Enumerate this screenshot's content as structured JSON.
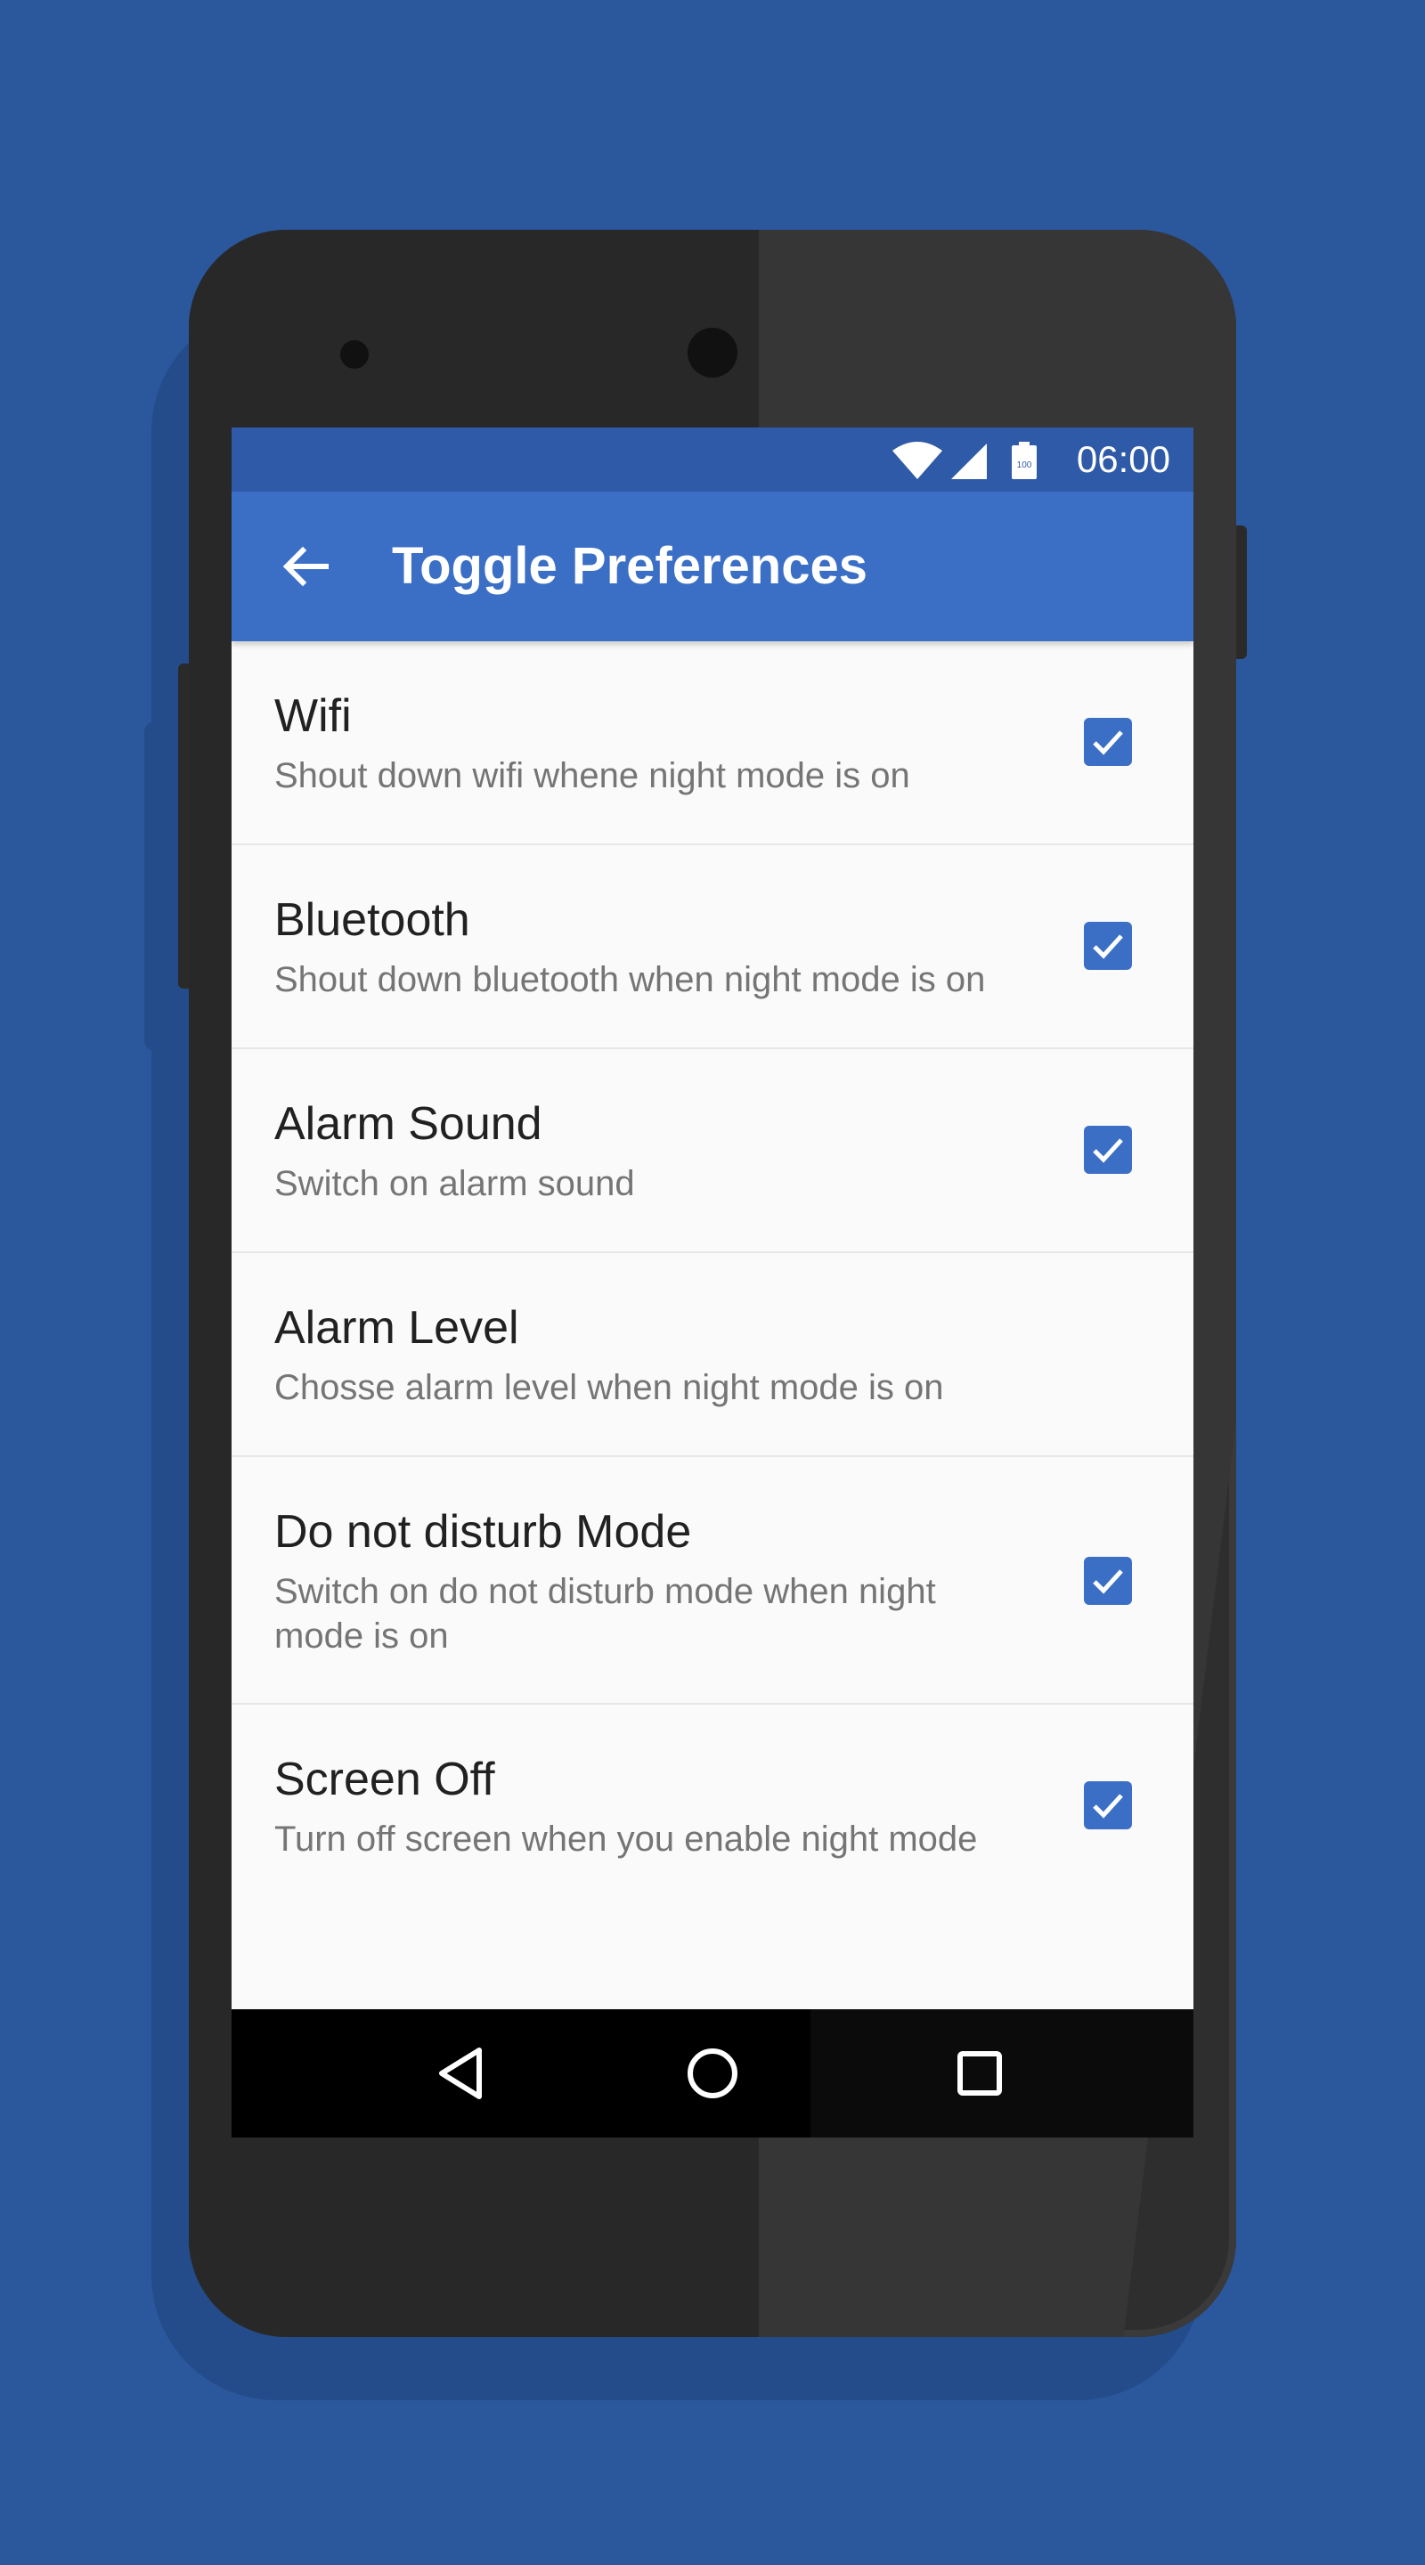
{
  "status_bar": {
    "time": "06:00",
    "battery_label": "100",
    "icons": [
      "wifi-icon",
      "signal-icon",
      "battery-icon"
    ]
  },
  "app_bar": {
    "title": "Toggle Preferences",
    "back_icon": "arrow-left-icon"
  },
  "preferences": [
    {
      "title": "Wifi",
      "subtitle": "Shout down wifi whene night mode is on",
      "checked": true
    },
    {
      "title": "Bluetooth",
      "subtitle": "Shout down bluetooth when night mode is on",
      "checked": true
    },
    {
      "title": "Alarm Sound",
      "subtitle": "Switch on alarm sound",
      "checked": true
    },
    {
      "title": "Alarm Level",
      "subtitle": "Chosse alarm level when night mode is on",
      "checked": false
    },
    {
      "title": "Do not disturb Mode",
      "subtitle": "Switch on do not disturb mode when night mode is on",
      "checked": true
    },
    {
      "title": "Screen Off",
      "subtitle": "Turn off screen when you enable night mode",
      "checked": true
    }
  ],
  "nav_bar": {
    "icons": [
      "back-triangle-icon",
      "home-circle-icon",
      "recents-square-icon"
    ]
  },
  "colors": {
    "background": "#2b579d",
    "primary": "#3b6fc6",
    "primary_dark": "#2f5aa7",
    "checkbox": "#3b6fc6"
  }
}
